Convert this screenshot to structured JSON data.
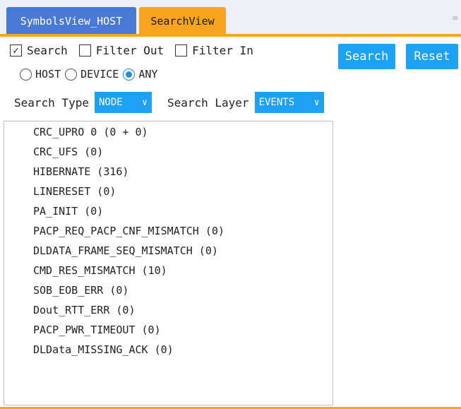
{
  "tabs": [
    {
      "label": "SymbolsView_HOST"
    },
    {
      "label": "SearchView"
    }
  ],
  "tab_scroll_glyph": "=",
  "filters": {
    "search": {
      "label": "Search",
      "checked": true
    },
    "filter_out": {
      "label": "Filter Out",
      "checked": false
    },
    "filter_in": {
      "label": "Filter In",
      "checked": false
    }
  },
  "scope": {
    "options": [
      "HOST",
      "DEVICE",
      "ANY"
    ],
    "selected": "ANY"
  },
  "buttons": {
    "search": "Search",
    "reset": "Reset"
  },
  "search_type": {
    "label": "Search Type",
    "value": "NODE"
  },
  "search_layer": {
    "label": "Search Layer",
    "value": "EVENTS"
  },
  "results": [
    "CRC_UPRO 0 (0 + 0)",
    "CRC_UFS (0)",
    "HIBERNATE (316)",
    "LINERESET (0)",
    "PA_INIT (0)",
    "PACP_REQ_PACP_CNF_MISMATCH (0)",
    "DLDATA_FRAME_SEQ_MISMATCH (0)",
    "CMD_RES_MISMATCH (10)",
    "SOB_EOB_ERR (0)",
    "Dout_RTT_ERR (0)",
    "PACP_PWR_TIMEOUT (0)",
    "DLData_MISSING_ACK (0)"
  ],
  "colors": {
    "accent_orange": "#f7a51e",
    "tab_blue": "#4a78d6",
    "button_blue": "#1da1f2"
  }
}
